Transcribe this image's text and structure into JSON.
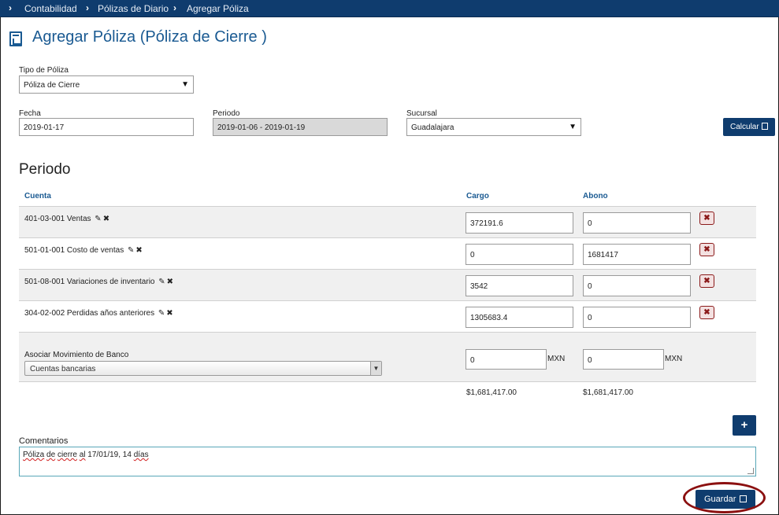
{
  "breadcrumb": [
    "Contabilidad",
    "Pólizas de Diario",
    "Agregar Póliza"
  ],
  "page_title": "Agregar Póliza (Póliza de Cierre )",
  "form": {
    "tipo_label": "Tipo de Póliza",
    "tipo_value": "Póliza de Cierre",
    "fecha_label": "Fecha",
    "fecha_value": "2019-01-17",
    "periodo_label": "Periodo",
    "periodo_value": "2019-01-06 - 2019-01-19",
    "sucursal_label": "Sucursal",
    "sucursal_value": "Guadalajara",
    "calcular_label": "Calcular"
  },
  "section_title": "Periodo",
  "table": {
    "headers": {
      "cuenta": "Cuenta",
      "cargo": "Cargo",
      "abono": "Abono"
    },
    "rows": [
      {
        "cuenta": "401-03-001 Ventas",
        "cargo": "372191.6",
        "abono": "0"
      },
      {
        "cuenta": "501-01-001 Costo de ventas",
        "cargo": "0",
        "abono": "1681417"
      },
      {
        "cuenta": "501-08-001 Variaciones de inventario",
        "cargo": "3542",
        "abono": "0"
      },
      {
        "cuenta": "304-02-002 Perdidas años anteriores",
        "cargo": "1305683.4",
        "abono": "0"
      }
    ]
  },
  "bank": {
    "label": "Asociar Movimiento de Banco",
    "select_value": "Cuentas bancarias",
    "cargo_value": "0",
    "abono_value": "0",
    "currency": "MXN"
  },
  "totals": {
    "cargo": "$1,681,417.00",
    "abono": "$1,681,417.00"
  },
  "comments": {
    "label": "Comentarios",
    "value_parts": [
      "Póliza",
      " ",
      "de",
      " ",
      "cierre",
      " ",
      "al",
      " 17/01/19, 14 ",
      "días"
    ]
  },
  "guardar_label": "Guardar",
  "icons": {
    "crumb_separator": "chevron-right-icon",
    "title": "document-chart-icon",
    "edit": "edit-icon",
    "remove": "close-icon",
    "calculator": "calculator-icon",
    "add": "plus-icon",
    "save": "save-icon"
  },
  "colors": {
    "primary": "#0f3c6e",
    "accent": "#1a5a92",
    "danger": "#8b1a1a"
  }
}
